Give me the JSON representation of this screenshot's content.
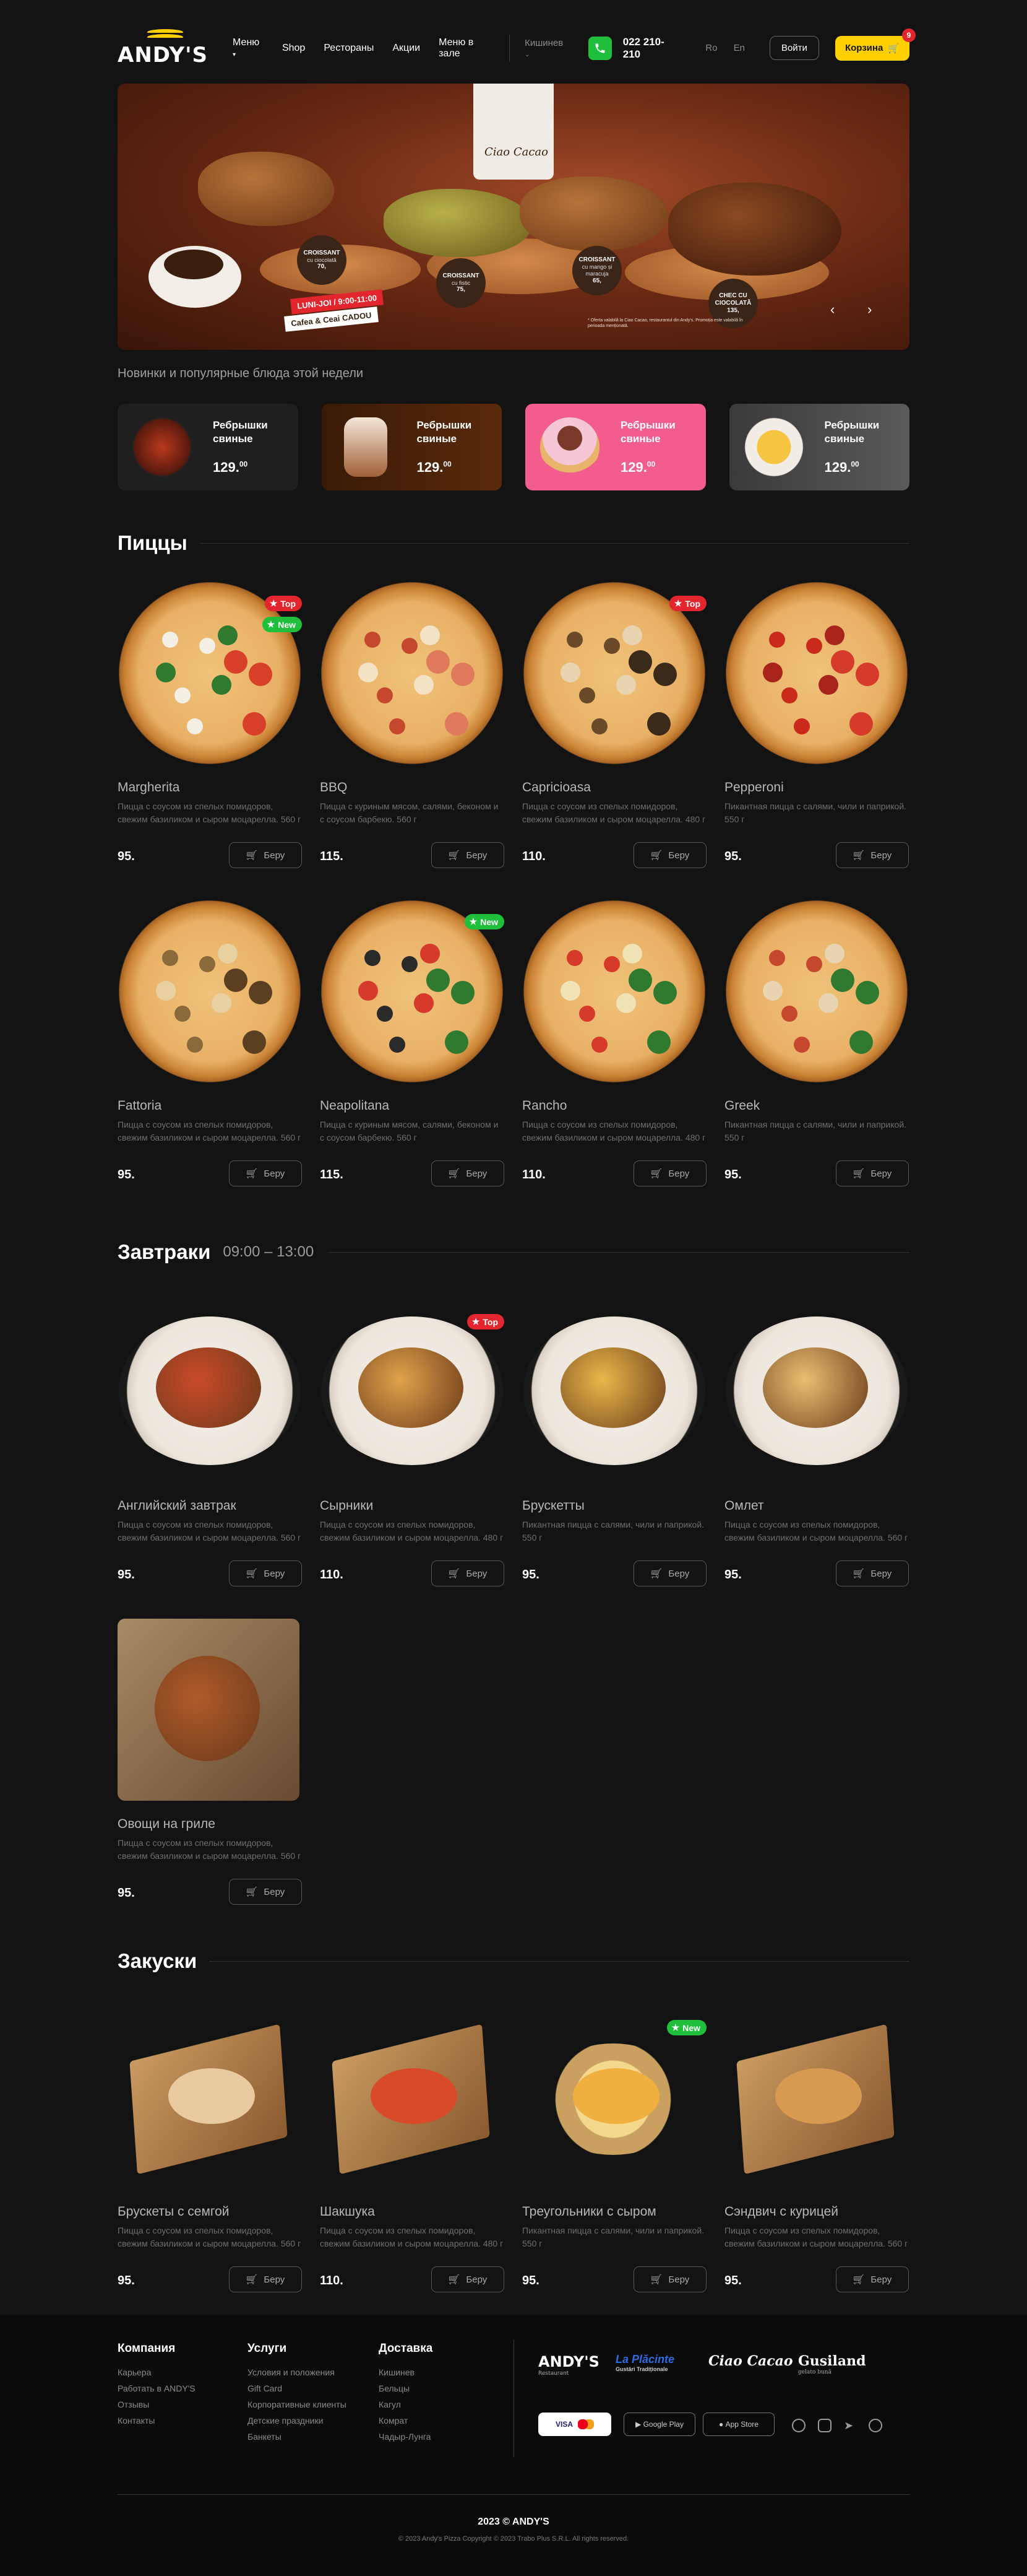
{
  "header": {
    "logo": "ANDY'S",
    "nav": [
      "Меню",
      "Shop",
      "Рестораны",
      "Акции",
      "Меню в зале"
    ],
    "city": "Кишинев",
    "phone": "022 210-210",
    "langs": [
      "Ro",
      "En"
    ],
    "login": "Войти",
    "cart": "Корзина",
    "cart_count": "9"
  },
  "hero": {
    "bag_brand": "Ciao Cacao",
    "tags": [
      {
        "t": "CROISSANT",
        "s": "cu ciocolată",
        "p": "70,"
      },
      {
        "t": "CROISSANT",
        "s": "cu fistic",
        "p": "75,"
      },
      {
        "t": "CROISSANT",
        "s": "cu mango și maracuja",
        "p": "65,"
      },
      {
        "t": "CHEC CU CIOCOLATĂ",
        "s": "",
        "p": "135,"
      }
    ],
    "promo_days": "LUNI-JOI / 9:00-11:00",
    "promo_name": "Cafea & Ceai CADOU",
    "fine_print": "* Oferta valabilă la Ciao Cacao, restaurantul din Andy's. Promoția este valabilă în perioada menționată."
  },
  "new_section_title": "Новинки и популярные блюда этой недели",
  "new_items": [
    {
      "title": "Ребрышки свиные",
      "price": "129.",
      "cents": "00"
    },
    {
      "title": "Ребрышки свиные",
      "price": "129.",
      "cents": "00"
    },
    {
      "title": "Ребрышки свиные",
      "price": "129.",
      "cents": "00"
    },
    {
      "title": "Ребрышки свиные",
      "price": "129.",
      "cents": "00"
    }
  ],
  "buy_label": "Беру",
  "pizza_section": {
    "title": "Пиццы",
    "items": [
      {
        "name": "Margherita",
        "desc": "Пицца с соусом из спелых помидоров, свежим базиликом и сыром моцарелла. 560 г",
        "price": "95.",
        "badges": [
          "Top",
          "New"
        ]
      },
      {
        "name": "BBQ",
        "desc": "Пицца с куриным мясом, салями, беконом и с соусом барбекю. 560 г",
        "price": "115.",
        "badges": []
      },
      {
        "name": "Capricioasa",
        "desc": "Пицца с соусом из спелых помидоров, свежим базиликом и сыром моцарелла. 480 г",
        "price": "110.",
        "badges": [
          "Top"
        ]
      },
      {
        "name": "Pepperoni",
        "desc": "Пикантная пицца с салями, чили и паприкой. 550 г",
        "price": "95.",
        "badges": []
      },
      {
        "name": "Fattoria",
        "desc": "Пицца с соусом из спелых помидоров, свежим базиликом и сыром моцарелла. 560 г",
        "price": "95.",
        "badges": []
      },
      {
        "name": "Neapolitana",
        "desc": "Пицца с куриным мясом, салями, беконом и с соусом барбекю. 560 г",
        "price": "115.",
        "badges": [
          "New"
        ]
      },
      {
        "name": "Rancho",
        "desc": "Пицца с соусом из спелых помидоров, свежим базиликом и сыром моцарелла. 480 г",
        "price": "110.",
        "badges": []
      },
      {
        "name": "Greek",
        "desc": "Пикантная пицца с салями, чили и паприкой. 550 г",
        "price": "95.",
        "badges": []
      }
    ]
  },
  "breakfast_section": {
    "title": "Завтраки",
    "time": "09:00 – 13:00",
    "items": [
      {
        "name": "Английский завтрак",
        "desc": "Пицца с соусом из спелых помидоров, свежим базиликом и сыром моцарелла. 560 г",
        "price": "95.",
        "badges": []
      },
      {
        "name": "Сырники",
        "desc": "Пицца с соусом из спелых помидоров, свежим базиликом и сыром моцарелла. 480 г",
        "price": "110.",
        "badges": [
          "Top"
        ]
      },
      {
        "name": "Брускетты",
        "desc": "Пикантная пицца с салями, чили и паприкой. 550 г",
        "price": "95.",
        "badges": []
      },
      {
        "name": "Омлет",
        "desc": "Пицца с соусом из спелых помидоров, свежим базиликом и сыром моцарелла. 560 г",
        "price": "95.",
        "badges": []
      },
      {
        "name": "Овощи на гриле",
        "desc": "Пицца с соусом из спелых помидоров, свежим базиликом и сыром моцарелла. 560 г",
        "price": "95.",
        "badges": []
      }
    ]
  },
  "snacks_section": {
    "title": "Закуски",
    "items": [
      {
        "name": "Брускеты с семгой",
        "desc": "Пицца с соусом из спелых помидоров, свежим базиликом и сыром моцарелла. 560 г",
        "price": "95.",
        "badges": []
      },
      {
        "name": "Шакшука",
        "desc": "Пицца с соусом из спелых помидоров, свежим базиликом и сыром моцарелла. 480 г",
        "price": "110.",
        "badges": []
      },
      {
        "name": "Треугольники с сыром",
        "desc": "Пикантная пицца с салями, чили и паприкой. 550 г",
        "price": "95.",
        "badges": [
          "New"
        ]
      },
      {
        "name": "Сэндвич с курицей",
        "desc": "Пицца с соусом из спелых помидоров, свежим базиликом и сыром моцарелла. 560 г",
        "price": "95.",
        "badges": []
      }
    ]
  },
  "footer": {
    "company": {
      "title": "Компания",
      "links": [
        "Карьера",
        "Работать в ANDY'S",
        "Отзывы",
        "Контакты"
      ]
    },
    "services": {
      "title": "Услуги",
      "links": [
        "Условия и положения",
        "Gift Card",
        "Корпоративные клиенты",
        "Детские праздники",
        "Банкеты"
      ]
    },
    "delivery": {
      "title": "Доставка",
      "links": [
        "Кишинев",
        "Бельцы",
        "Кагул",
        "Комрат",
        "Чадыр-Лунга"
      ]
    },
    "brands": [
      "ANDY'S",
      "La Plăcinte",
      "Ciao Cacao",
      "Gusiland"
    ],
    "brand_subs": [
      "Restaurant",
      "Gustări Tradiționale",
      "",
      "gelato bună"
    ],
    "payments": [
      "VISA",
      "Google Play",
      "App Store"
    ],
    "copyright": "2023 © ANDY'S",
    "legal": "© 2023 Andy's Pizza Copyright © 2023 Trabo Plus S.R.L. All rights reserved."
  },
  "colors": {
    "accent": "#ffd000",
    "top_badge": "#e3262e",
    "new_badge": "#1fbf3b",
    "bg": "#131313"
  }
}
